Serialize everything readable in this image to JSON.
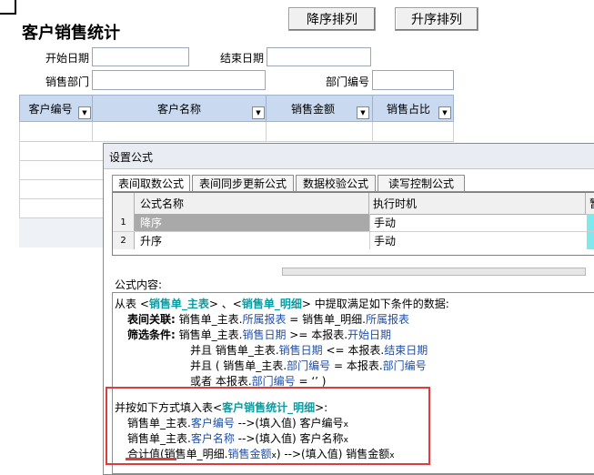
{
  "toolbar": {
    "desc_button": "降序排列",
    "asc_button": "升序排列"
  },
  "report": {
    "title": "客户销售统计",
    "filters": {
      "start_date": "开始日期",
      "end_date": "结束日期",
      "sales_dept": "销售部门",
      "dept_code": "部门编号"
    },
    "columns": [
      "客户编号",
      "客户名称",
      "销售金额",
      "销售占比"
    ]
  },
  "dialog": {
    "title": "设置公式",
    "tabs": [
      "表间取数公式",
      "表间同步更新公式",
      "数据校验公式",
      "读写控制公式"
    ],
    "table": {
      "headers": [
        "公式名称",
        "执行时机",
        "暂"
      ],
      "rows": [
        {
          "num": "1",
          "name": "降序",
          "timing": "手动"
        },
        {
          "num": "2",
          "name": "升序",
          "timing": "手动"
        }
      ]
    },
    "content_label": "公式内容:",
    "formula": {
      "l1": {
        "a": "从表 <",
        "b": "销售单_主表",
        "c": "> 、<",
        "d": "销售单_明细",
        "e": "> 中提取满足如下条件的数据:"
      },
      "l2": {
        "a": "表间关联:",
        "b": "销售单_主表.",
        "c": "所属报表",
        "d": " = 销售单_明细.",
        "e": "所属报表"
      },
      "l3": {
        "a": "筛选条件:",
        "b": "销售单_主表.",
        "c": "销售日期",
        "d": " >= 本报表.",
        "e": "开始日期"
      },
      "l4": {
        "a": "并且 销售单_主表.",
        "b": "销售日期",
        "c": " <= 本报表.",
        "d": "结束日期"
      },
      "l5": {
        "a": "并且 ( 销售单_主表.",
        "b": "部门编号",
        "c": " = 本报表.",
        "d": "部门编号"
      },
      "l6": {
        "a": "或者 本报表.",
        "b": "部门编号",
        "c": " = ‘’ )"
      },
      "l7": {
        "a": "并按如下方式填入表<",
        "b": "客户销售统计_明细",
        "c": ">:"
      },
      "l8": {
        "a": "销售单_主表.",
        "b": "客户编号",
        "c": " -->(填入值) 客户编号",
        "d": "x"
      },
      "l9": {
        "a": "销售单_主表.",
        "b": "客户名称",
        "c": " -->(填入值) 客户名称",
        "d": "x"
      },
      "l10": {
        "a": "合计值(销售单_明细.",
        "b": "销售金额",
        "c": "x",
        "d": ")  -->(填入值) 销售金额",
        "e": "x"
      }
    }
  },
  "colors": {
    "accent_red": "#e13a3a",
    "table_name": "#0a9aa0",
    "field_blue": "#1f4ea8",
    "grid_header": "#c9d9ef"
  }
}
